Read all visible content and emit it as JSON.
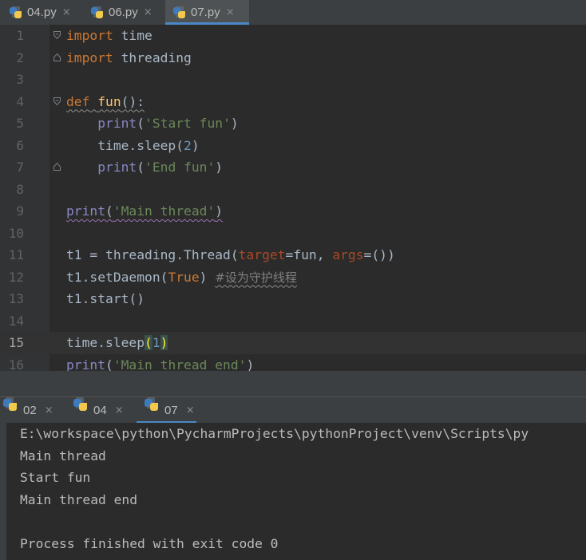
{
  "editor_tabs": [
    {
      "label": "04.py",
      "close": "×",
      "active": false
    },
    {
      "label": "06.py",
      "close": "×",
      "active": false
    },
    {
      "label": "07.py",
      "close": "×",
      "active": true
    }
  ],
  "code": {
    "current_line": 15,
    "lines": [
      {
        "num": "1",
        "tokens": [
          {
            "t": "import",
            "c": "kw"
          },
          {
            "t": " time"
          }
        ]
      },
      {
        "num": "2",
        "tokens": [
          {
            "t": "import",
            "c": "kw"
          },
          {
            "t": " threading"
          }
        ]
      },
      {
        "num": "3",
        "tokens": []
      },
      {
        "num": "4",
        "tokens": [
          {
            "t": "def",
            "c": "kw wavy-g"
          },
          {
            "t": " ",
            "c": "wavy-g"
          },
          {
            "t": "fun",
            "c": "fn wavy-g"
          },
          {
            "t": "():",
            "c": "wavy-g"
          }
        ]
      },
      {
        "num": "5",
        "tokens": [
          {
            "t": "    "
          },
          {
            "t": "print",
            "c": "bi"
          },
          {
            "t": "("
          },
          {
            "t": "'Start fun'",
            "c": "str"
          },
          {
            "t": ")"
          }
        ]
      },
      {
        "num": "6",
        "tokens": [
          {
            "t": "    time.sleep("
          },
          {
            "t": "2",
            "c": "num"
          },
          {
            "t": ")"
          }
        ]
      },
      {
        "num": "7",
        "tokens": [
          {
            "t": "    "
          },
          {
            "t": "print",
            "c": "bi"
          },
          {
            "t": "("
          },
          {
            "t": "'End fun'",
            "c": "str"
          },
          {
            "t": ")"
          }
        ]
      },
      {
        "num": "8",
        "tokens": []
      },
      {
        "num": "9",
        "tokens": [
          {
            "t": "print",
            "c": "bi wavy"
          },
          {
            "t": "(",
            "c": "wavy"
          },
          {
            "t": "'Main thread'",
            "c": "str wavy"
          },
          {
            "t": ")",
            "c": "wavy"
          }
        ]
      },
      {
        "num": "10",
        "tokens": []
      },
      {
        "num": "11",
        "tokens": [
          {
            "t": "t1 = threading.Thread("
          },
          {
            "t": "target",
            "c": "par"
          },
          {
            "t": "=fun, "
          },
          {
            "t": "args",
            "c": "par"
          },
          {
            "t": "=())"
          }
        ]
      },
      {
        "num": "12",
        "tokens": [
          {
            "t": "t1.setDaemon("
          },
          {
            "t": "True",
            "c": "kw"
          },
          {
            "t": ") "
          },
          {
            "t": "#设为守护线程",
            "c": "cmt wavy-g"
          }
        ]
      },
      {
        "num": "13",
        "tokens": [
          {
            "t": "t1.start()"
          }
        ]
      },
      {
        "num": "14",
        "tokens": []
      },
      {
        "num": "15",
        "tokens": [
          {
            "t": "time.sleep"
          },
          {
            "t": "(",
            "c": "brace"
          },
          {
            "t": "1",
            "c": "num"
          },
          {
            "t": ")",
            "c": "brace"
          }
        ]
      },
      {
        "num": "16",
        "tokens": [
          {
            "t": "print",
            "c": "bi"
          },
          {
            "t": "("
          },
          {
            "t": "'Main thread end'",
            "c": "str"
          },
          {
            "t": ")",
            "c": "wavy-g"
          }
        ]
      }
    ]
  },
  "run_tabs": [
    {
      "label": "02",
      "close": "×",
      "active": false
    },
    {
      "label": "04",
      "close": "×",
      "active": false
    },
    {
      "label": "07",
      "close": "×",
      "active": true
    }
  ],
  "console": {
    "lines": [
      "E:\\workspace\\python\\PycharmProjects\\pythonProject\\venv\\Scripts\\py",
      "Main thread",
      "Start fun",
      "Main thread end",
      "",
      "Process finished with exit code 0"
    ]
  },
  "colors": {
    "background": "#2b2b2b",
    "accent": "#4a88c7",
    "keyword": "#cc7832",
    "string": "#6a8759"
  },
  "icons": {
    "python_file": "python-file-icon",
    "close": "close-icon",
    "fold": "fold-marker-icon"
  }
}
